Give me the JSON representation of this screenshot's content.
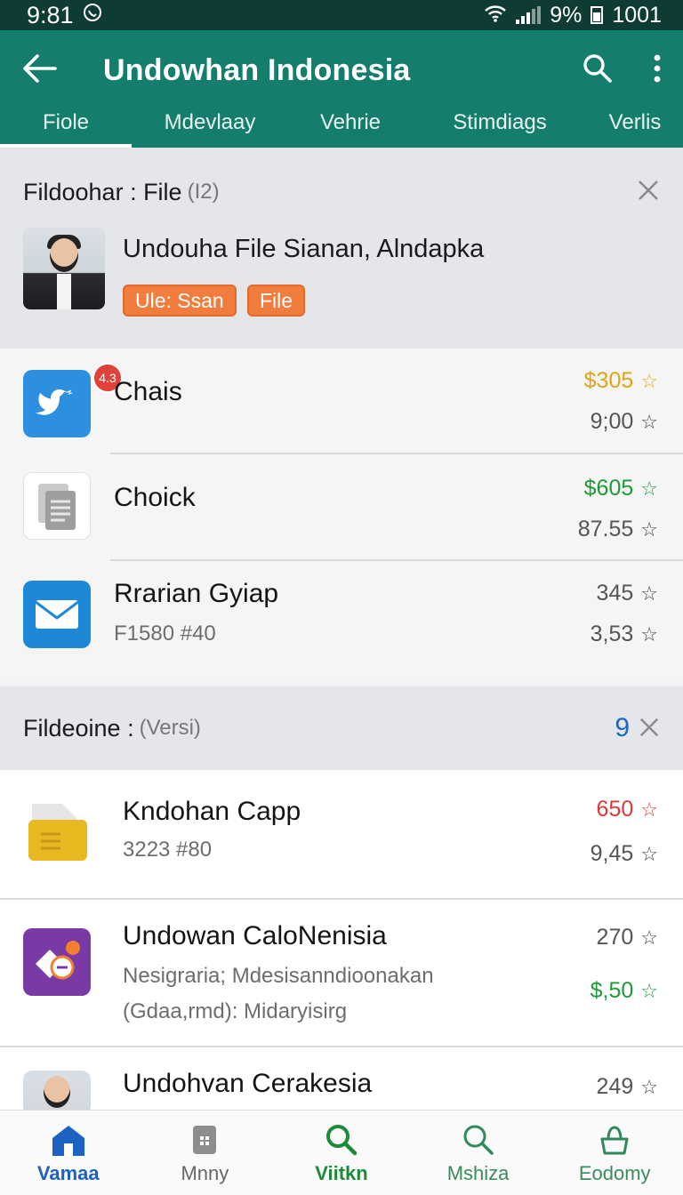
{
  "status": {
    "time": "9:81",
    "battery": "9%",
    "extra": "1001"
  },
  "appbar": {
    "title": "Undowhan Indonesia"
  },
  "tabs": [
    "Fiole",
    "Mdevlaay",
    "Vehrie",
    "Stimdiags",
    "Verlis"
  ],
  "section1": {
    "title": "Fildoohar : File",
    "count": "(I2)",
    "feature": {
      "title": "Undouha File Sianan, Alndapka",
      "chips": [
        "Ule: Ssan",
        "File"
      ]
    },
    "items": [
      {
        "name": "Chais",
        "badge": "4.3",
        "price": "$305",
        "price_color": "#e0a316",
        "value2": "9;00"
      },
      {
        "name": "Choick",
        "price": "$605",
        "price_color": "#1d9a35",
        "value2": "87.55"
      },
      {
        "name": "Rrarian Gyiap",
        "sub": "F1580 #40",
        "price": "345",
        "price_color": "#555555",
        "value2": "3,53"
      }
    ]
  },
  "section2": {
    "title": "Fildeoine :",
    "count": "(Versi)",
    "badge": "9",
    "items": [
      {
        "name": "Kndohan Capp",
        "sub": "3223 #80",
        "price": "650",
        "price_color": "#d93a36",
        "value2": "9,45"
      },
      {
        "name": "Undowan CaloNenisia",
        "sub": "Nesigraria; Mdesisanndioonakan",
        "sub2": "(Gdaa,rmd): Midaryisirg",
        "price": "270",
        "price_color": "#555555",
        "value2": "$,50",
        "value2_color": "#1d9a35"
      },
      {
        "name": "Undohvan Cerakesia",
        "price": "249",
        "price_color": "#555555"
      }
    ]
  },
  "bottomnav": [
    "Vamaa",
    "Mnny",
    "Viitkn",
    "Mshiza",
    "Eodomy"
  ]
}
